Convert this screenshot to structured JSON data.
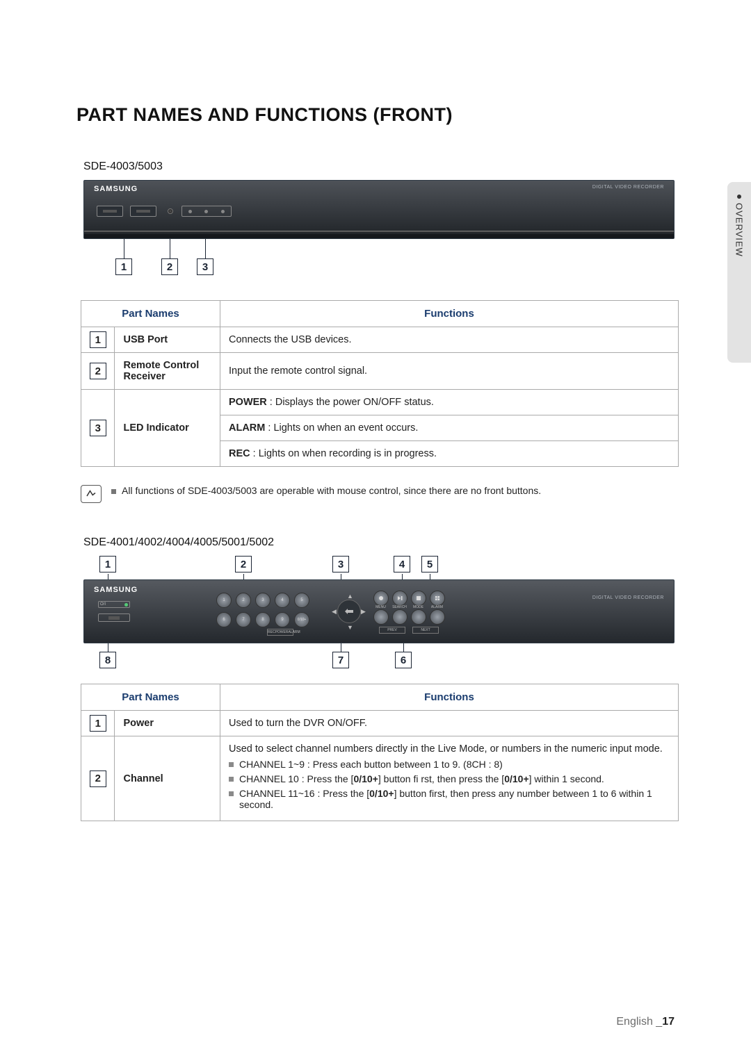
{
  "sideTab": "OVERVIEW",
  "title": "PART NAMES AND FUNCTIONS (FRONT)",
  "model1": "SDE-4003/5003",
  "brand": "SAMSUNG",
  "recorderLabel": "DIGITAL VIDEO RECORDER",
  "table1": {
    "headers": {
      "parts": "Part Names",
      "functions": "Functions"
    },
    "rows": {
      "r1": {
        "num": "1",
        "name": "USB Port",
        "fn": "Connects the USB devices."
      },
      "r2": {
        "num": "2",
        "name": "Remote Control Receiver",
        "fn": "Input the remote control signal."
      },
      "r3_num": "3",
      "r3_name": "LED Indicator",
      "r3a_strong": "POWER",
      "r3a_rest": " : Displays the power ON/OFF status.",
      "r3b_strong": "ALARM",
      "r3b_rest": " : Lights on when an event occurs.",
      "r3c_strong": "REC",
      "r3c_rest": " : Lights on when recording is in progress."
    }
  },
  "noteText": "All functions of SDE-4003/5003 are operable with mouse control, since there are no front buttons.",
  "model2": "SDE-4001/4002/4004/4005/5001/5002",
  "panel2": {
    "pwrLabel": "O/I",
    "numbers": [
      "1",
      "2",
      "3",
      "4",
      "5",
      "6",
      "7",
      "8",
      "9",
      "0/10+"
    ],
    "playTop": [
      "● REC",
      "▶/II",
      "■",
      "🔳"
    ],
    "menuLabels": [
      "MENU",
      "SEARCH",
      "MODE",
      "ALARM"
    ],
    "recLed": [
      "REC",
      "POWER",
      "ALARM"
    ],
    "bottom": [
      "PREV",
      "NEXT"
    ]
  },
  "calloutsTop2": [
    "1",
    "2",
    "3",
    "4",
    "5"
  ],
  "calloutsBottom2": [
    "8",
    "7",
    "6"
  ],
  "table2": {
    "headers": {
      "parts": "Part Names",
      "functions": "Functions"
    },
    "rows": {
      "r1": {
        "num": "1",
        "name": "Power",
        "fn": "Used to turn the DVR ON/OFF."
      },
      "r2_num": "2",
      "r2_name": "Channel",
      "r2_intro": "Used to select channel numbers directly in the Live Mode, or numbers in the numeric input mode.",
      "r2_b1": "CHANNEL 1~9 : Press each button between 1 to 9. (8CH : 8)",
      "r2_b2_a": "CHANNEL 10 : Press the [",
      "r2_b2_s1": "0/10+",
      "r2_b2_b": "] button fi rst, then press the [",
      "r2_b2_s2": "0/10+",
      "r2_b2_c": "] within 1 second.",
      "r2_b3_a": "CHANNEL 11~16 : Press the [",
      "r2_b3_s1": "0/10+",
      "r2_b3_b": "] button first, then press any number between 1 to 6 within 1 second."
    }
  },
  "footer": {
    "lang": "English _",
    "page": "17"
  }
}
